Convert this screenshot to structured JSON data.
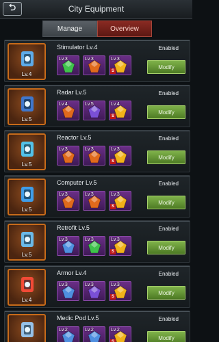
{
  "header": {
    "title": "City Equipment",
    "back_icon": "back-arrow-icon"
  },
  "tabs": [
    {
      "label": "Manage",
      "active": false
    },
    {
      "label": "Overview",
      "active": true
    }
  ],
  "items": [
    {
      "name": "Stimulator Lv.4",
      "level": "Lv.4",
      "status": "Enabled",
      "action": "Modify",
      "slots": [
        {
          "lv": "Lv.3",
          "gem": "green",
          "s": false
        },
        {
          "lv": "Lv.3",
          "gem": "orange",
          "s": false
        },
        {
          "lv": "Lv.3",
          "gem": "yellow",
          "s": true
        }
      ]
    },
    {
      "name": "Radar Lv.5",
      "level": "Lv.5",
      "status": "Enabled",
      "action": "Modify",
      "slots": [
        {
          "lv": "Lv.4",
          "gem": "orange",
          "s": false
        },
        {
          "lv": "Lv.5",
          "gem": "purple",
          "s": false
        },
        {
          "lv": "Lv.4",
          "gem": "yellow",
          "s": true
        }
      ]
    },
    {
      "name": "Reactor Lv.5",
      "level": "Lv.5",
      "status": "Enabled",
      "action": "Modify",
      "slots": [
        {
          "lv": "Lv.3",
          "gem": "orange",
          "s": false
        },
        {
          "lv": "Lv.3",
          "gem": "orange",
          "s": false
        },
        {
          "lv": "Lv.3",
          "gem": "yellow",
          "s": true
        }
      ]
    },
    {
      "name": "Computer Lv.5",
      "level": "Lv.5",
      "status": "Enabled",
      "action": "Modify",
      "slots": [
        {
          "lv": "Lv.3",
          "gem": "orange",
          "s": false
        },
        {
          "lv": "Lv.3",
          "gem": "orange",
          "s": false
        },
        {
          "lv": "Lv.3",
          "gem": "yellow",
          "s": true
        }
      ]
    },
    {
      "name": "Retrofit Lv.5",
      "level": "Lv.5",
      "status": "Enabled",
      "action": "Modify",
      "slots": [
        {
          "lv": "Lv.3",
          "gem": "blue",
          "s": false
        },
        {
          "lv": "Lv.3",
          "gem": "green",
          "s": false
        },
        {
          "lv": "Lv.3",
          "gem": "yellow",
          "s": true
        }
      ]
    },
    {
      "name": "Armor Lv.4",
      "level": "Lv.4",
      "status": "Enabled",
      "action": "Modify",
      "slots": [
        {
          "lv": "Lv.3",
          "gem": "blue",
          "s": false
        },
        {
          "lv": "Lv.3",
          "gem": "purple",
          "s": false
        },
        {
          "lv": "Lv.3",
          "gem": "yellow",
          "s": true
        }
      ]
    },
    {
      "name": "Medic Pod Lv.5",
      "level": "Lv.5",
      "status": "Enabled",
      "action": "Modify",
      "slots": [
        {
          "lv": "Lv.2",
          "gem": "blue",
          "s": false
        },
        {
          "lv": "Lv.2",
          "gem": "blue",
          "s": false
        },
        {
          "lv": "Lv.2",
          "gem": "yellow",
          "s": true
        }
      ]
    }
  ],
  "colors": {
    "green": "#3fc24c",
    "orange": "#e06a1c",
    "yellow": "#f2b21a",
    "purple": "#7a4fd6",
    "blue": "#4f8fe0"
  }
}
